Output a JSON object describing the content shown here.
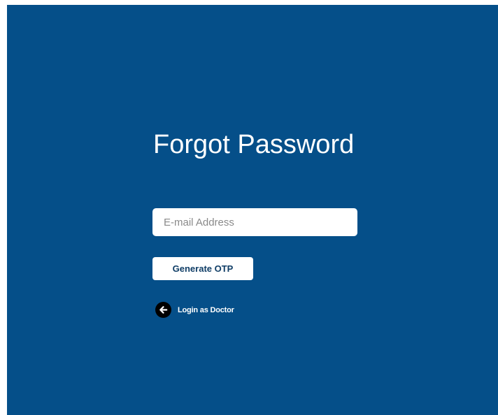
{
  "page": {
    "title": "Forgot Password",
    "background_color": "#054F89"
  },
  "form": {
    "email_placeholder": "E-mail Address",
    "email_value": "",
    "submit_label": "Generate OTP"
  },
  "back_link": {
    "label": "Login as Doctor",
    "icon": "arrow-left-circle-icon"
  }
}
